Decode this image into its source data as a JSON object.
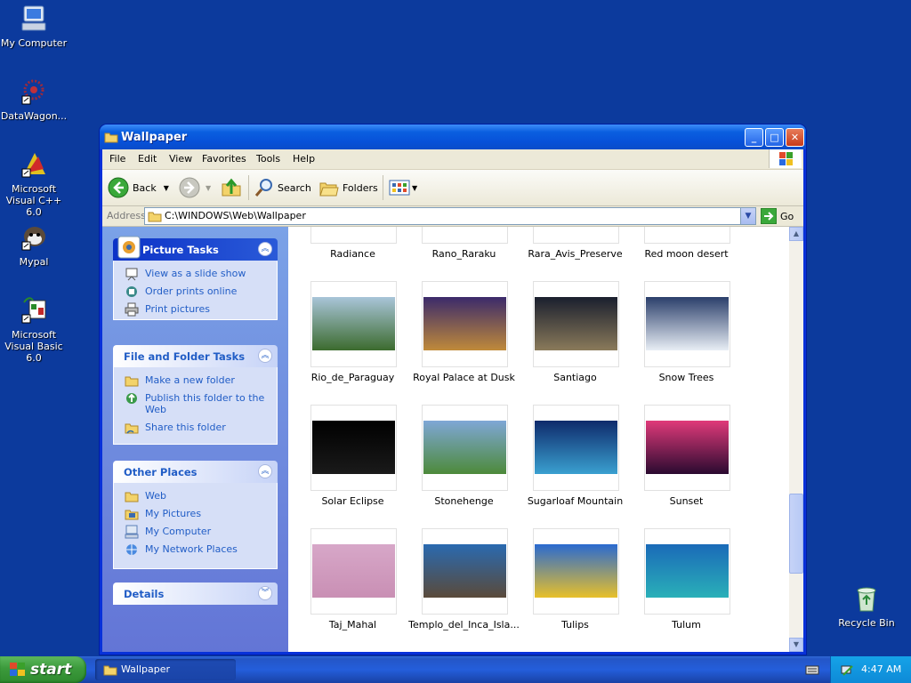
{
  "desktop": {
    "icons": [
      {
        "label": "My Computer",
        "icon": "my-computer-icon"
      },
      {
        "label": "DataWagon...",
        "icon": "datawagon-icon"
      },
      {
        "label": "Microsoft Visual C++ 6.0",
        "icon": "visual-cpp-icon"
      },
      {
        "label": "Mypal",
        "icon": "mypal-icon"
      },
      {
        "label": "Microsoft Visual Basic 6.0",
        "icon": "visual-basic-icon"
      },
      {
        "label": "Recycle Bin",
        "icon": "recycle-bin-icon"
      }
    ]
  },
  "window": {
    "title": "Wallpaper",
    "menu": [
      "File",
      "Edit",
      "View",
      "Favorites",
      "Tools",
      "Help"
    ],
    "toolbar": {
      "back": "Back",
      "search": "Search",
      "folders": "Folders"
    },
    "address": {
      "label": "Address",
      "value": "C:\\WINDOWS\\Web\\Wallpaper",
      "go": "Go"
    },
    "tasks": {
      "picture": {
        "title": "Picture Tasks",
        "items": [
          "View as a slide show",
          "Order prints online",
          "Print pictures"
        ]
      },
      "file_folder": {
        "title": "File and Folder Tasks",
        "items": [
          "Make a new folder",
          "Publish this folder to the Web",
          "Share this folder"
        ]
      },
      "other": {
        "title": "Other Places",
        "items": [
          "Web",
          "My Pictures",
          "My Computer",
          "My Network Places"
        ]
      },
      "details": {
        "title": "Details"
      }
    },
    "files": [
      {
        "name": "Radiance",
        "colors": [
          "#6e6a62",
          "#b9b2a3"
        ]
      },
      {
        "name": "Rano_Raraku",
        "colors": [
          "#6b3a16",
          "#b9772c"
        ]
      },
      {
        "name": "Rara_Avis_Preserve",
        "colors": [
          "#1f2c2a",
          "#4f6b5c"
        ]
      },
      {
        "name": "Red moon desert",
        "colors": [
          "#6b2510",
          "#c0582a"
        ]
      },
      {
        "name": "Rio_de_Paraguay",
        "colors": [
          "#a9c5d9",
          "#3c6b2e"
        ]
      },
      {
        "name": "Royal Palace at Dusk",
        "colors": [
          "#3b2a6b",
          "#c08a3a"
        ]
      },
      {
        "name": "Santiago",
        "colors": [
          "#1a1f2e",
          "#8a7a5a"
        ]
      },
      {
        "name": "Snow Trees",
        "colors": [
          "#2b3f6b",
          "#e8eef5"
        ]
      },
      {
        "name": "Solar Eclipse",
        "colors": [
          "#000000",
          "#1a1a1a"
        ]
      },
      {
        "name": "Stonehenge",
        "colors": [
          "#7fa7d6",
          "#4d8a3a"
        ]
      },
      {
        "name": "Sugarloaf Mountain",
        "colors": [
          "#0e2a6b",
          "#3aa0d0"
        ]
      },
      {
        "name": "Sunset",
        "colors": [
          "#e03a7a",
          "#2a0a30"
        ]
      },
      {
        "name": "Taj_Mahal",
        "colors": [
          "#d7a7c8",
          "#c98fb4"
        ]
      },
      {
        "name": "Templo_del_Inca_Isla...",
        "colors": [
          "#2a6ab0",
          "#5a4a3a"
        ]
      },
      {
        "name": "Tulips",
        "colors": [
          "#2a6ad0",
          "#e8c02a"
        ]
      },
      {
        "name": "Tulum",
        "colors": [
          "#1a6ab8",
          "#2ab0b8"
        ]
      }
    ]
  },
  "taskbar": {
    "start": "start",
    "task_label": "Wallpaper",
    "clock": "4:47 AM"
  }
}
